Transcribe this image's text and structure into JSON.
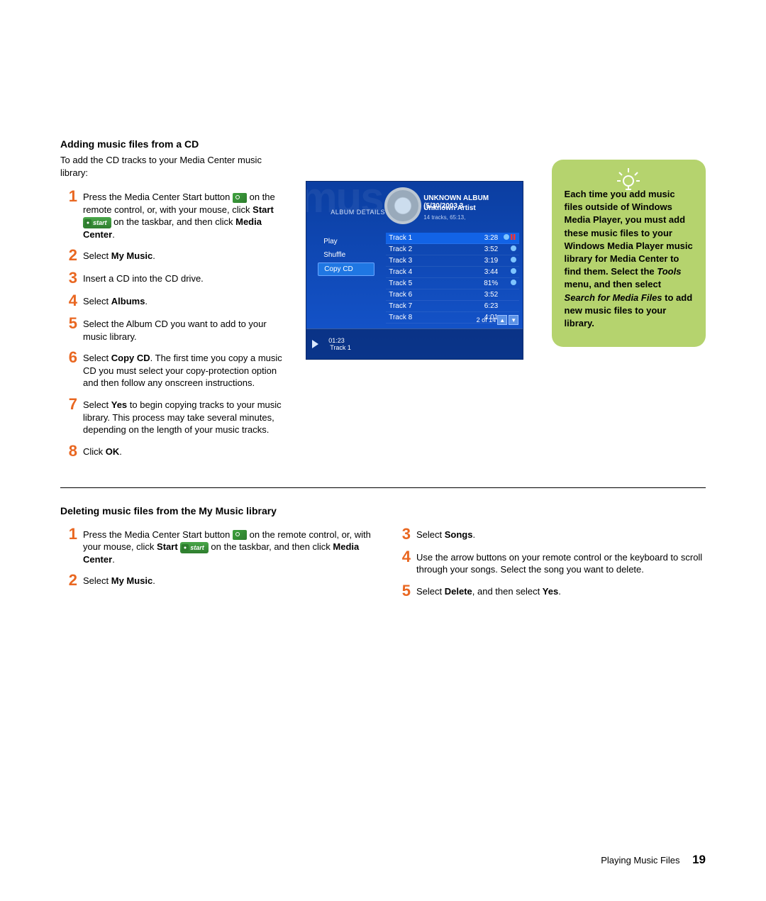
{
  "section1": {
    "title": "Adding music files from a CD",
    "intro": "To add the CD tracks to your Media Center music library:",
    "steps": [
      {
        "num": "1",
        "pre": "Press the Media Center Start button ",
        "mid1": " on the remote control, or, with your mouse, click ",
        "bold1": "Start",
        "mid2": " ",
        "mid3": " on the taskbar, and then click ",
        "bold2": "Media Center",
        "post": "."
      },
      {
        "num": "2",
        "pre": "Select ",
        "bold1": "My Music",
        "post": "."
      },
      {
        "num": "3",
        "pre": "Insert a CD into the CD drive."
      },
      {
        "num": "4",
        "pre": "Select ",
        "bold1": "Albums",
        "post": "."
      },
      {
        "num": "5",
        "pre": "Select the Album CD you want to add to your music library."
      },
      {
        "num": "6",
        "pre": "Select ",
        "bold1": "Copy CD",
        "post": ". The first time you copy a music CD you must select your copy-protection option and then follow any onscreen instructions."
      },
      {
        "num": "7",
        "pre": "Select ",
        "bold1": "Yes",
        "post": " to begin copying tracks to your music library. This process may take several minutes, depending on the length of your music tracks."
      },
      {
        "num": "8",
        "pre": "Click ",
        "bold1": "OK",
        "post": "."
      }
    ]
  },
  "screenshot": {
    "bg_word": "mus",
    "album_details_label": "ALBUM DETAILS",
    "album_title": "UNKNOWN ALBUM (5/30/2003 3",
    "artist": "Unknown Artist",
    "meta": "14 tracks, 65:13,",
    "menu": {
      "play": "Play",
      "shuffle": "Shuffle",
      "copy": "Copy CD"
    },
    "tracks": [
      {
        "name": "Track 1",
        "time": "3:28",
        "dot": true,
        "bars": true
      },
      {
        "name": "Track 2",
        "time": "3:52",
        "dot": true
      },
      {
        "name": "Track 3",
        "time": "3:19",
        "dot": true
      },
      {
        "name": "Track 4",
        "time": "3:44",
        "dot": true
      },
      {
        "name": "Track 5",
        "time": "81%",
        "dot": true
      },
      {
        "name": "Track 6",
        "time": "3:52"
      },
      {
        "name": "Track 7",
        "time": "6:23"
      },
      {
        "name": "Track 8",
        "time": "4:01"
      }
    ],
    "pager": "2 of 14",
    "footer_time": "01:23",
    "footer_track": "Track 1"
  },
  "tip": {
    "t1": "Each time you add music files outside of Windows Media Player, you must add these music files to your Windows Media Player music library for Media Center to find them. Select the ",
    "i1": "Tools",
    "t2": " menu, and then select ",
    "i2": "Search for Media Files",
    "t3": " to add new music files to your library."
  },
  "section2": {
    "title": "Deleting music files from the My Music library",
    "left": [
      {
        "num": "1",
        "pre": "Press the Media Center Start button ",
        "mid1": " on the remote control, or, with your mouse, click ",
        "bold1": "Start",
        "mid2": " ",
        "mid3": " on the taskbar, and then click ",
        "bold2": "Media Center",
        "post": "."
      },
      {
        "num": "2",
        "pre": "Select ",
        "bold1": "My Music",
        "post": "."
      }
    ],
    "right": [
      {
        "num": "3",
        "pre": "Select ",
        "bold1": "Songs",
        "post": "."
      },
      {
        "num": "4",
        "pre": "Use the arrow buttons on your remote control or the keyboard to scroll through your songs. Select the song you want to delete."
      },
      {
        "num": "5",
        "pre": "Select ",
        "bold1": "Delete",
        "mid1": ", and then select ",
        "bold2": "Yes",
        "post": "."
      }
    ]
  },
  "footer": {
    "section": "Playing Music Files",
    "page": "19"
  },
  "start_label": "start"
}
